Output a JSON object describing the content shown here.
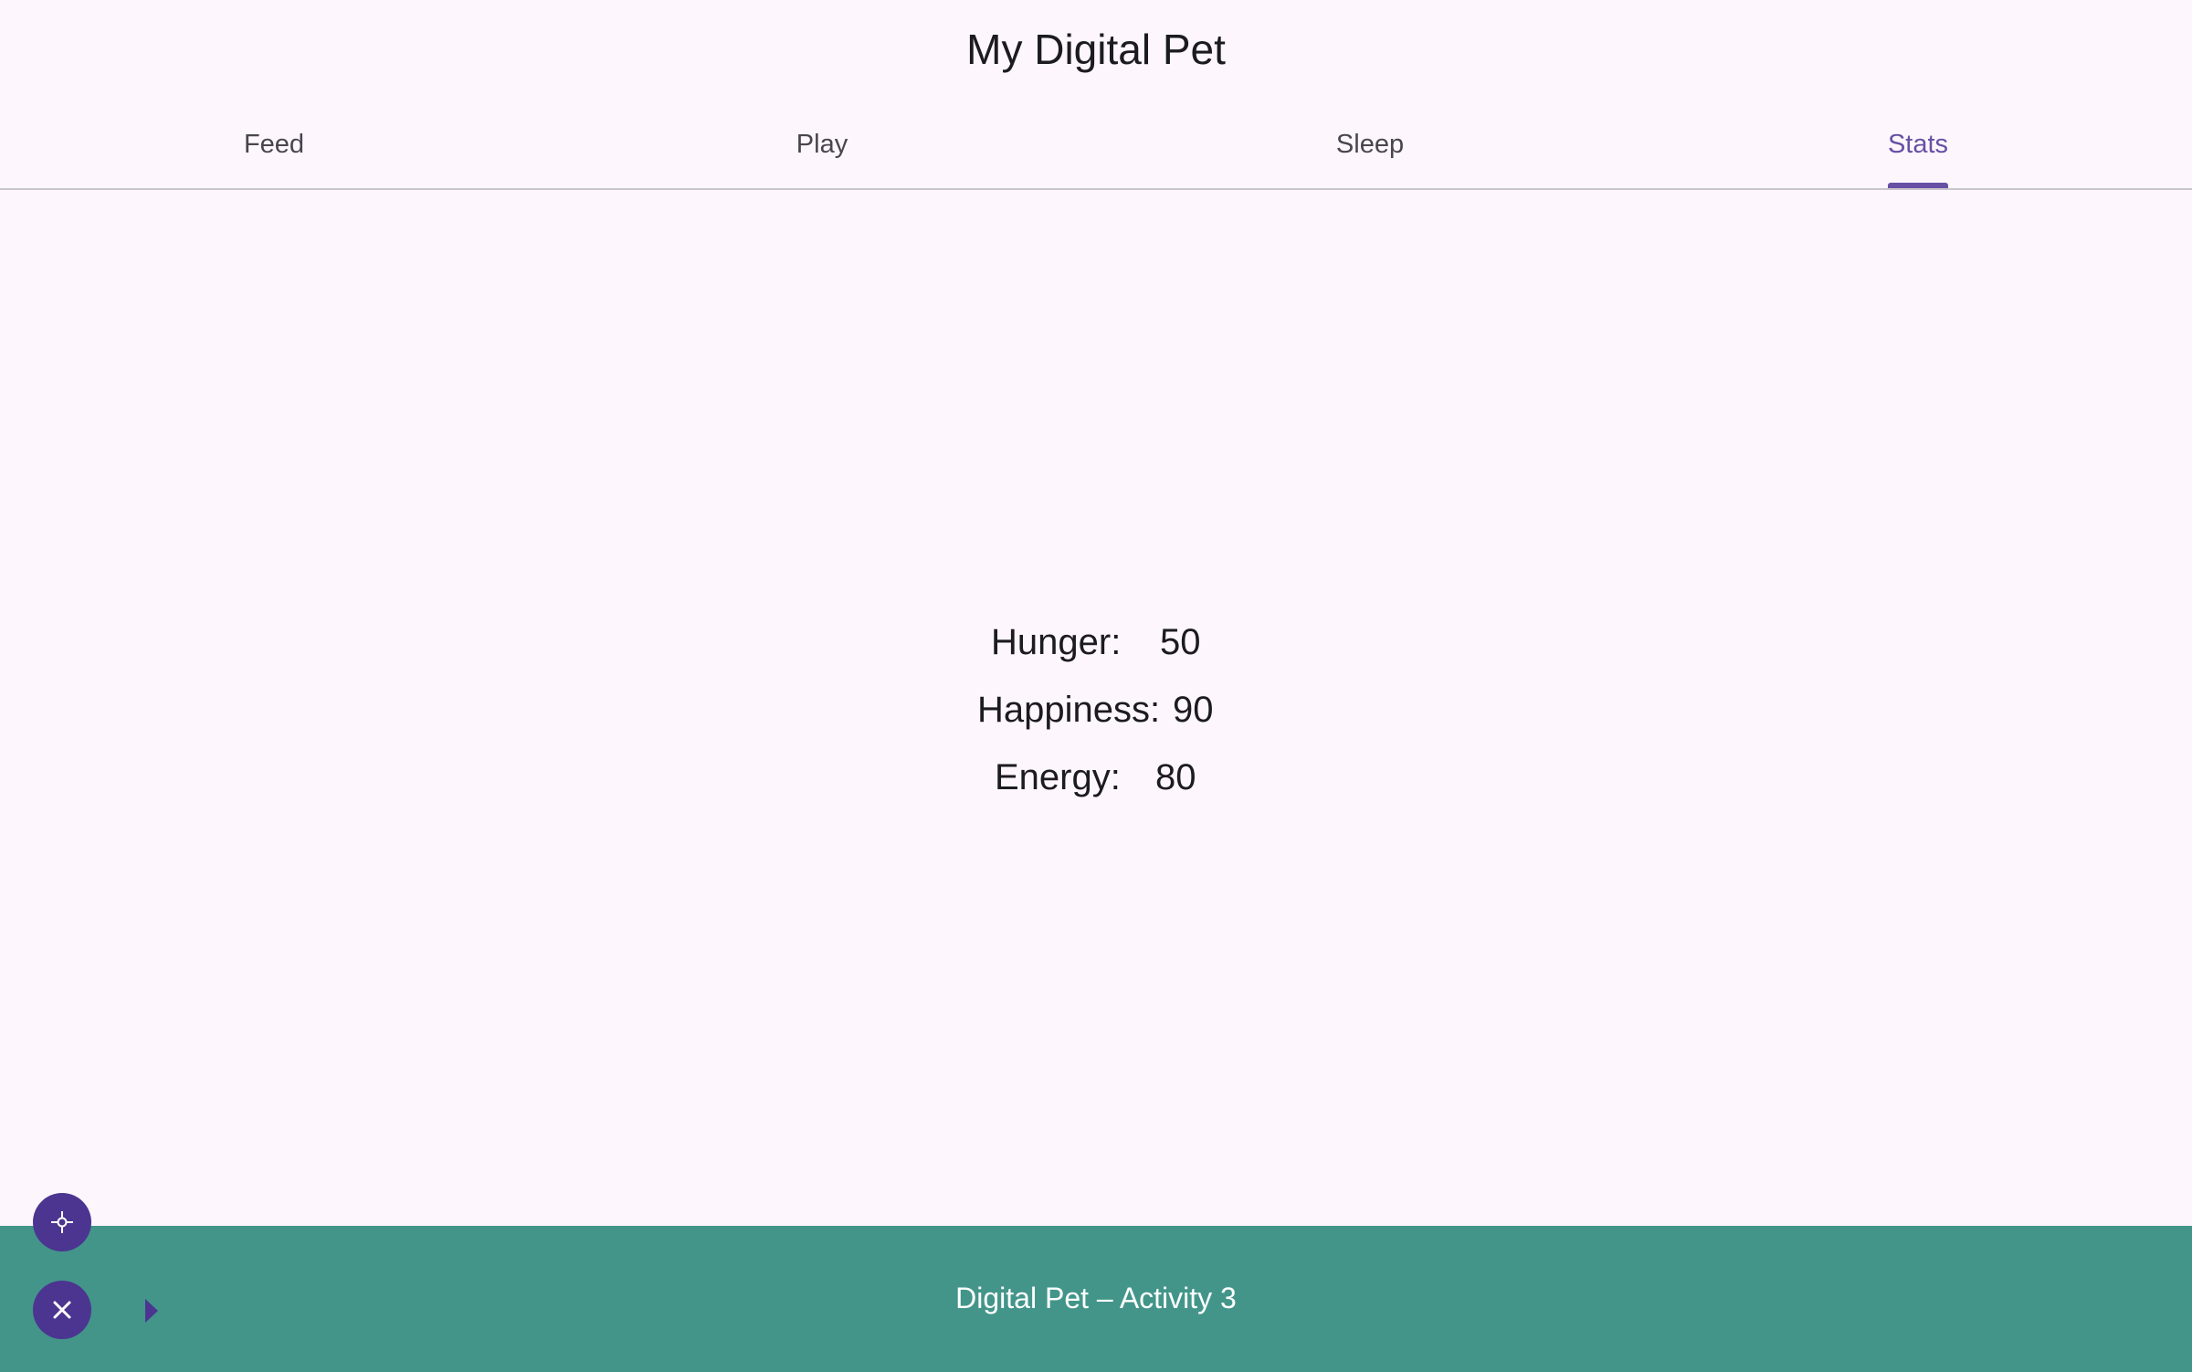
{
  "app": {
    "title": "My Digital Pet"
  },
  "tabs": [
    {
      "label": "Feed",
      "active": false
    },
    {
      "label": "Play",
      "active": false
    },
    {
      "label": "Sleep",
      "active": false
    },
    {
      "label": "Stats",
      "active": true
    }
  ],
  "stats": [
    {
      "label": "Hunger:",
      "value": "50"
    },
    {
      "label": "Happiness:",
      "value": "90"
    },
    {
      "label": "Energy:",
      "value": "80"
    }
  ],
  "footer": {
    "title": "Digital Pet – Activity 3"
  },
  "controls": {
    "locate_icon": "crosshair-icon",
    "close_icon": "close-icon",
    "expand_icon": "play-arrow-icon"
  },
  "colors": {
    "background": "#fdf7fd",
    "accent": "#6750a4",
    "fab": "#4b3590",
    "footer": "#43958a"
  }
}
